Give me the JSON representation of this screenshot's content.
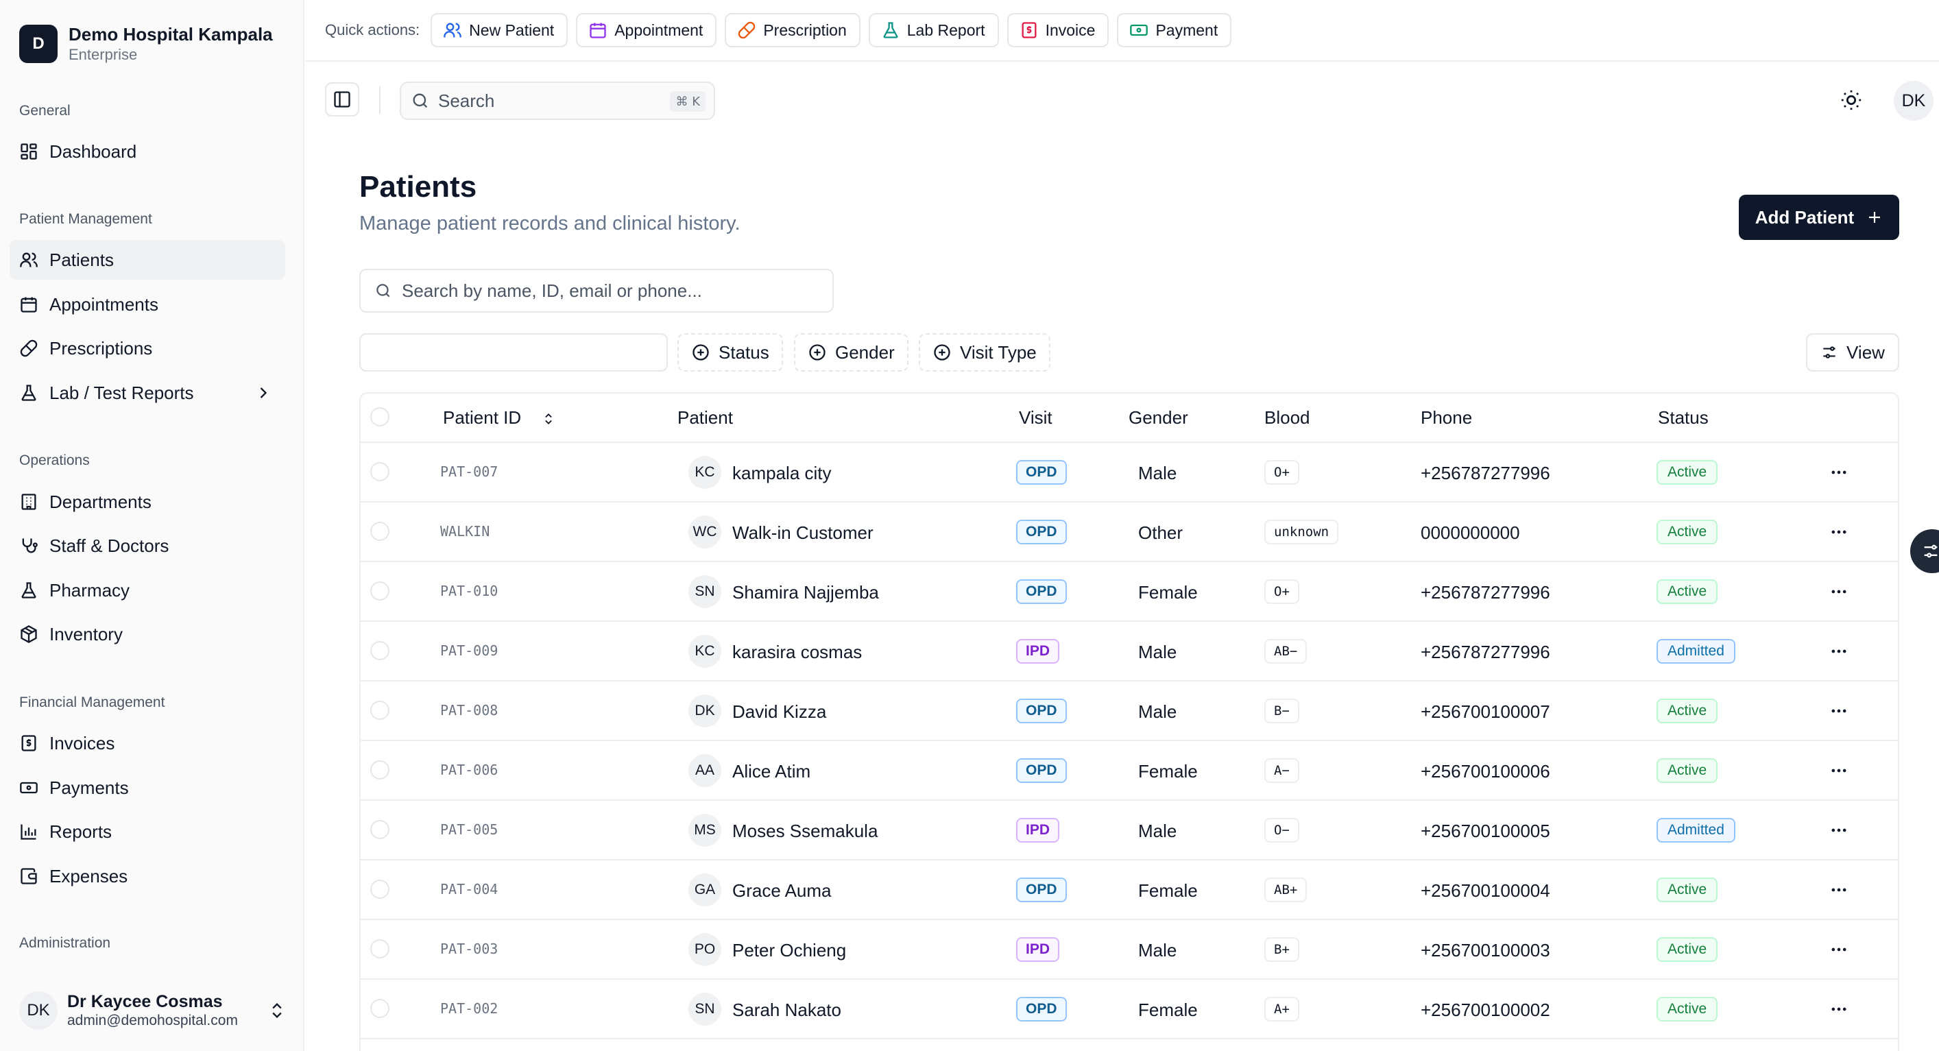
{
  "org": {
    "initial": "D",
    "name": "Demo Hospital Kampala",
    "plan": "Enterprise"
  },
  "sidebar": {
    "groups": [
      {
        "label": "General"
      },
      {
        "label": "Patient Management"
      },
      {
        "label": "Operations"
      },
      {
        "label": "Financial Management"
      },
      {
        "label": "Administration"
      }
    ],
    "items": [
      {
        "label": "Dashboard",
        "icon": "dashboard-icon"
      },
      {
        "label": "Patients",
        "icon": "users-icon"
      },
      {
        "label": "Appointments",
        "icon": "calendar-icon"
      },
      {
        "label": "Prescriptions",
        "icon": "pill-icon"
      },
      {
        "label": "Lab / Test Reports",
        "icon": "flask-icon"
      },
      {
        "label": "Departments",
        "icon": "building-icon"
      },
      {
        "label": "Staff & Doctors",
        "icon": "stethoscope-icon"
      },
      {
        "label": "Pharmacy",
        "icon": "flask-icon"
      },
      {
        "label": "Inventory",
        "icon": "package-icon"
      },
      {
        "label": "Invoices",
        "icon": "receipt-icon"
      },
      {
        "label": "Payments",
        "icon": "banknote-icon"
      },
      {
        "label": "Reports",
        "icon": "bar-chart-icon"
      },
      {
        "label": "Expenses",
        "icon": "wallet-icon"
      }
    ]
  },
  "user": {
    "initials": "DK",
    "name": "Dr Kaycee Cosmas",
    "email": "admin@demohospital.com"
  },
  "quick_actions": {
    "label": "Quick actions:",
    "items": [
      {
        "label": "New Patient",
        "icon": "users-icon",
        "color": "#2563eb"
      },
      {
        "label": "Appointment",
        "icon": "calendar-icon",
        "color": "#9333ea"
      },
      {
        "label": "Prescription",
        "icon": "pill-icon",
        "color": "#ea580c"
      },
      {
        "label": "Lab Report",
        "icon": "flask-icon",
        "color": "#0d9488"
      },
      {
        "label": "Invoice",
        "icon": "receipt-icon",
        "color": "#e11d48"
      },
      {
        "label": "Payment",
        "icon": "banknote-icon",
        "color": "#059669"
      }
    ]
  },
  "header": {
    "search_placeholder": "Search",
    "shortcut": "⌘ K",
    "avatar_initials": "DK"
  },
  "page": {
    "title": "Patients",
    "subtitle": "Manage patient records and clinical history.",
    "add_button": "Add Patient",
    "search_placeholder": "Search by name, ID, email or phone...",
    "filters": {
      "status": "Status",
      "gender": "Gender",
      "visit_type": "Visit Type"
    },
    "view_button": "View"
  },
  "table": {
    "columns": {
      "patient_id": "Patient ID",
      "patient": "Patient",
      "visit": "Visit",
      "gender": "Gender",
      "blood": "Blood",
      "phone": "Phone",
      "status": "Status"
    },
    "rows": [
      {
        "id": "PAT-007",
        "initials": "KC",
        "name": "kampala city",
        "visit": "OPD",
        "gender": "Male",
        "blood": "O+",
        "phone": "+256787277996",
        "status": "Active"
      },
      {
        "id": "WALKIN",
        "initials": "WC",
        "name": "Walk-in Customer",
        "visit": "OPD",
        "gender": "Other",
        "blood": "unknown",
        "phone": "0000000000",
        "status": "Active"
      },
      {
        "id": "PAT-010",
        "initials": "SN",
        "name": "Shamira Najjemba",
        "visit": "OPD",
        "gender": "Female",
        "blood": "O+",
        "phone": "+256787277996",
        "status": "Active"
      },
      {
        "id": "PAT-009",
        "initials": "KC",
        "name": "karasira cosmas",
        "visit": "IPD",
        "gender": "Male",
        "blood": "AB−",
        "phone": "+256787277996",
        "status": "Admitted"
      },
      {
        "id": "PAT-008",
        "initials": "DK",
        "name": "David Kizza",
        "visit": "OPD",
        "gender": "Male",
        "blood": "B−",
        "phone": "+256700100007",
        "status": "Active"
      },
      {
        "id": "PAT-006",
        "initials": "AA",
        "name": "Alice Atim",
        "visit": "OPD",
        "gender": "Female",
        "blood": "A−",
        "phone": "+256700100006",
        "status": "Active"
      },
      {
        "id": "PAT-005",
        "initials": "MS",
        "name": "Moses Ssemakula",
        "visit": "IPD",
        "gender": "Male",
        "blood": "O−",
        "phone": "+256700100005",
        "status": "Admitted"
      },
      {
        "id": "PAT-004",
        "initials": "GA",
        "name": "Grace Auma",
        "visit": "OPD",
        "gender": "Female",
        "blood": "AB+",
        "phone": "+256700100004",
        "status": "Active"
      },
      {
        "id": "PAT-003",
        "initials": "PO",
        "name": "Peter Ochieng",
        "visit": "IPD",
        "gender": "Male",
        "blood": "B+",
        "phone": "+256700100003",
        "status": "Active"
      },
      {
        "id": "PAT-002",
        "initials": "SN",
        "name": "Sarah Nakato",
        "visit": "OPD",
        "gender": "Female",
        "blood": "A+",
        "phone": "+256700100002",
        "status": "Active"
      }
    ]
  }
}
